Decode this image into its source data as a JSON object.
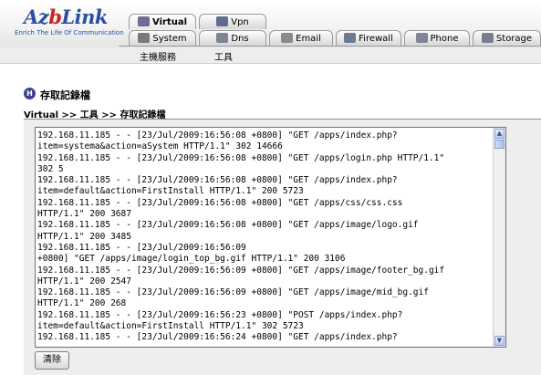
{
  "header": {
    "brand_prefix": "Az",
    "brand_highlight": "b",
    "brand_suffix": "Link",
    "tagline": "Enrich The Life Of Communication"
  },
  "tabs_row1": [
    {
      "label": "Virtual",
      "icon": "virtual-icon",
      "active": true
    },
    {
      "label": "Vpn",
      "icon": "vpn-icon",
      "active": false
    }
  ],
  "tabs_row2": [
    {
      "label": "System",
      "icon": "system-icon"
    },
    {
      "label": "Dns",
      "icon": "dns-icon"
    },
    {
      "label": "Email",
      "icon": "email-icon"
    },
    {
      "label": "Firewall",
      "icon": "firewall-icon"
    },
    {
      "label": "Phone",
      "icon": "phone-icon"
    },
    {
      "label": "Storage",
      "icon": "storage-icon"
    }
  ],
  "subnav": {
    "host_service": "主機服務",
    "tools": "工具"
  },
  "page": {
    "title_badge": "H",
    "title": "存取記錄檔",
    "breadcrumb": "Virtual >> 工具 >> 存取記錄檔"
  },
  "log_lines": [
    "192.168.11.185 - - [23/Jul/2009:16:56:08 +0800] \"GET /apps/index.php?",
    "item=systema&action=aSystem HTTP/1.1\" 302 14666",
    "192.168.11.185 - - [23/Jul/2009:16:56:08 +0800] \"GET /apps/login.php HTTP/1.1\"",
    "302 5",
    "192.168.11.185 - - [23/Jul/2009:16:56:08 +0800] \"GET /apps/index.php?",
    "item=default&action=FirstInstall HTTP/1.1\" 200 5723",
    "192.168.11.185 - - [23/Jul/2009:16:56:08 +0800] \"GET /apps/css/css.css",
    "HTTP/1.1\" 200 3687",
    "192.168.11.185 - - [23/Jul/2009:16:56:08 +0800] \"GET /apps/image/logo.gif",
    "HTTP/1.1\" 200 3485",
    "192.168.11.185 - - [23/Jul/2009:16:56:09",
    "+0800] \"GET /apps/image/login_top_bg.gif HTTP/1.1\" 200 3106",
    "192.168.11.185 - - [23/Jul/2009:16:56:09 +0800] \"GET /apps/image/footer_bg.gif",
    "HTTP/1.1\" 200 2547",
    "192.168.11.185 - - [23/Jul/2009:16:56:09 +0800] \"GET /apps/image/mid_bg.gif",
    "HTTP/1.1\" 200 268",
    "192.168.11.185 - - [23/Jul/2009:16:56:23 +0800] \"POST /apps/index.php?",
    "item=default&action=FirstInstall HTTP/1.1\" 302 5723",
    "192.168.11.185 - - [23/Jul/2009:16:56:24 +0800] \"GET /apps/index.php?"
  ],
  "buttons": {
    "clear": "清除"
  },
  "colors": {
    "brand_blue": "#2a4fa0",
    "brand_red": "#d22020",
    "title_badge": "#3b3f9a"
  }
}
